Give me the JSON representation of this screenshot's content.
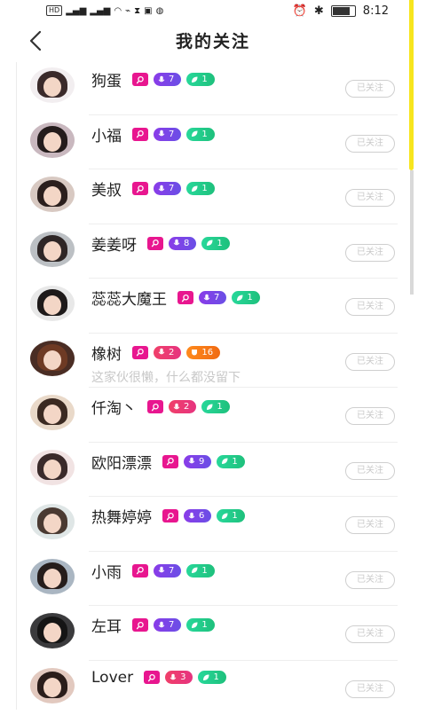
{
  "status_bar": {
    "left_indicators": "HD 2 4G 4G",
    "time": "8:12",
    "battery_pct": 0.75
  },
  "header": {
    "title": "我的关注",
    "back_icon": "chevron-left-icon"
  },
  "colors": {
    "key_tag": "#e8168f",
    "mic_pill": "#7a45e8",
    "leaf_pill": "#22cc8a",
    "follow_border": "#cfcfcf"
  },
  "users": [
    {
      "name": "狗蛋",
      "mic": "7",
      "mic_color": "purple",
      "second": "1",
      "second_type": "leaf",
      "note": "",
      "button": "已关注",
      "avatar": {
        "bg": "#f2eef0",
        "hair": "#3a2a2a"
      }
    },
    {
      "name": "小福",
      "mic": "7",
      "mic_color": "purple",
      "second": "1",
      "second_type": "leaf",
      "note": "",
      "button": "已关注",
      "avatar": {
        "bg": "#c9b8bf",
        "hair": "#241c1c"
      }
    },
    {
      "name": "美叔",
      "mic": "7",
      "mic_color": "purple",
      "second": "1",
      "second_type": "leaf",
      "note": "",
      "button": "已关注",
      "avatar": {
        "bg": "#d8c9c2",
        "hair": "#2b1f1d"
      }
    },
    {
      "name": "姜姜呀",
      "mic": "8",
      "mic_color": "purple",
      "second": "1",
      "second_type": "leaf",
      "note": "",
      "button": "已关注",
      "avatar": {
        "bg": "#bcc0c4",
        "hair": "#2e2626"
      }
    },
    {
      "name": "蕊蕊大魔王",
      "mic": "7",
      "mic_color": "purple",
      "second": "1",
      "second_type": "leaf",
      "note": "",
      "button": "已关注",
      "avatar": {
        "bg": "#e8e8e8",
        "hair": "#1e1a1a"
      }
    },
    {
      "name": "橡树",
      "mic": "2",
      "mic_color": "pink",
      "second": "16",
      "second_type": "orange",
      "note": "这家伙很懒，什么都没留下",
      "button": "已关注",
      "avatar": {
        "bg": "#4a2d24",
        "hair": "#6e3a24"
      }
    },
    {
      "name": "仟淘丶",
      "mic": "2",
      "mic_color": "pink",
      "second": "1",
      "second_type": "leaf",
      "note": "",
      "button": "已关注",
      "avatar": {
        "bg": "#e9d9c9",
        "hair": "#3b2a22"
      }
    },
    {
      "name": "欧阳漂漂",
      "mic": "9",
      "mic_color": "purple",
      "second": "1",
      "second_type": "leaf",
      "note": "",
      "button": "已关注",
      "avatar": {
        "bg": "#f1e3e3",
        "hair": "#3a2a2a"
      }
    },
    {
      "name": "热舞婷婷",
      "mic": "6",
      "mic_color": "purple",
      "second": "1",
      "second_type": "leaf",
      "note": "",
      "button": "已关注",
      "avatar": {
        "bg": "#dfe6e6",
        "hair": "#4a3a32"
      }
    },
    {
      "name": "小雨",
      "mic": "7",
      "mic_color": "purple",
      "second": "1",
      "second_type": "leaf",
      "note": "",
      "button": "已关注",
      "avatar": {
        "bg": "#aab6c2",
        "hair": "#261d1b"
      }
    },
    {
      "name": "左耳",
      "mic": "7",
      "mic_color": "purple",
      "second": "1",
      "second_type": "leaf",
      "note": "",
      "button": "已关注",
      "avatar": {
        "bg": "#3b3b3d",
        "hair": "#151515"
      }
    },
    {
      "name": "Lover",
      "mic": "3",
      "mic_color": "pink",
      "second": "1",
      "second_type": "leaf",
      "note": "",
      "button": "已关注",
      "avatar": {
        "bg": "#e2c9bf",
        "hair": "#2a1d1a"
      }
    }
  ]
}
